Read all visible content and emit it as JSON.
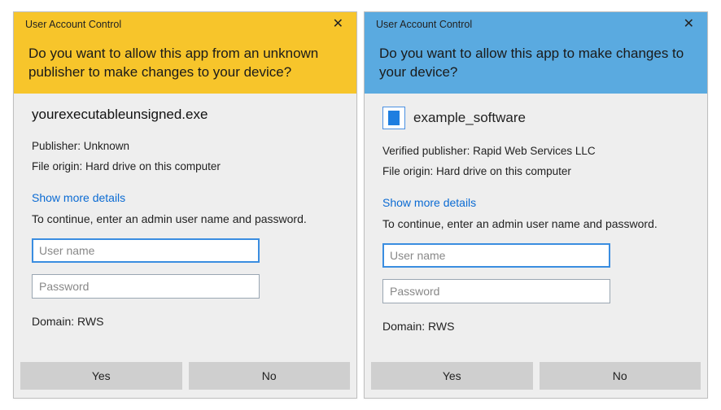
{
  "left": {
    "title": "User Account Control",
    "close_glyph": "✕",
    "banner": "Do you want to allow this app from an unknown publisher to make changes to your device?",
    "app_name": "yourexecutableunsigned.exe",
    "publisher_line": "Publisher: Unknown",
    "origin_line": "File origin: Hard drive on this computer",
    "show_more": "Show more details",
    "instruction": "To continue, enter an admin user name and password.",
    "username_placeholder": "User name",
    "password_placeholder": "Password",
    "domain_line": "Domain: RWS",
    "yes_label": "Yes",
    "no_label": "No"
  },
  "right": {
    "title": "User Account Control",
    "close_glyph": "✕",
    "banner": "Do you want to allow this app to make changes to your device?",
    "app_name": "example_software",
    "publisher_line": "Verified publisher: Rapid Web Services LLC",
    "origin_line": "File origin: Hard drive on this computer",
    "show_more": "Show more details",
    "instruction": "To continue, enter an admin user name and password.",
    "username_placeholder": "User name",
    "password_placeholder": "Password",
    "domain_line": "Domain: RWS",
    "yes_label": "Yes",
    "no_label": "No"
  }
}
